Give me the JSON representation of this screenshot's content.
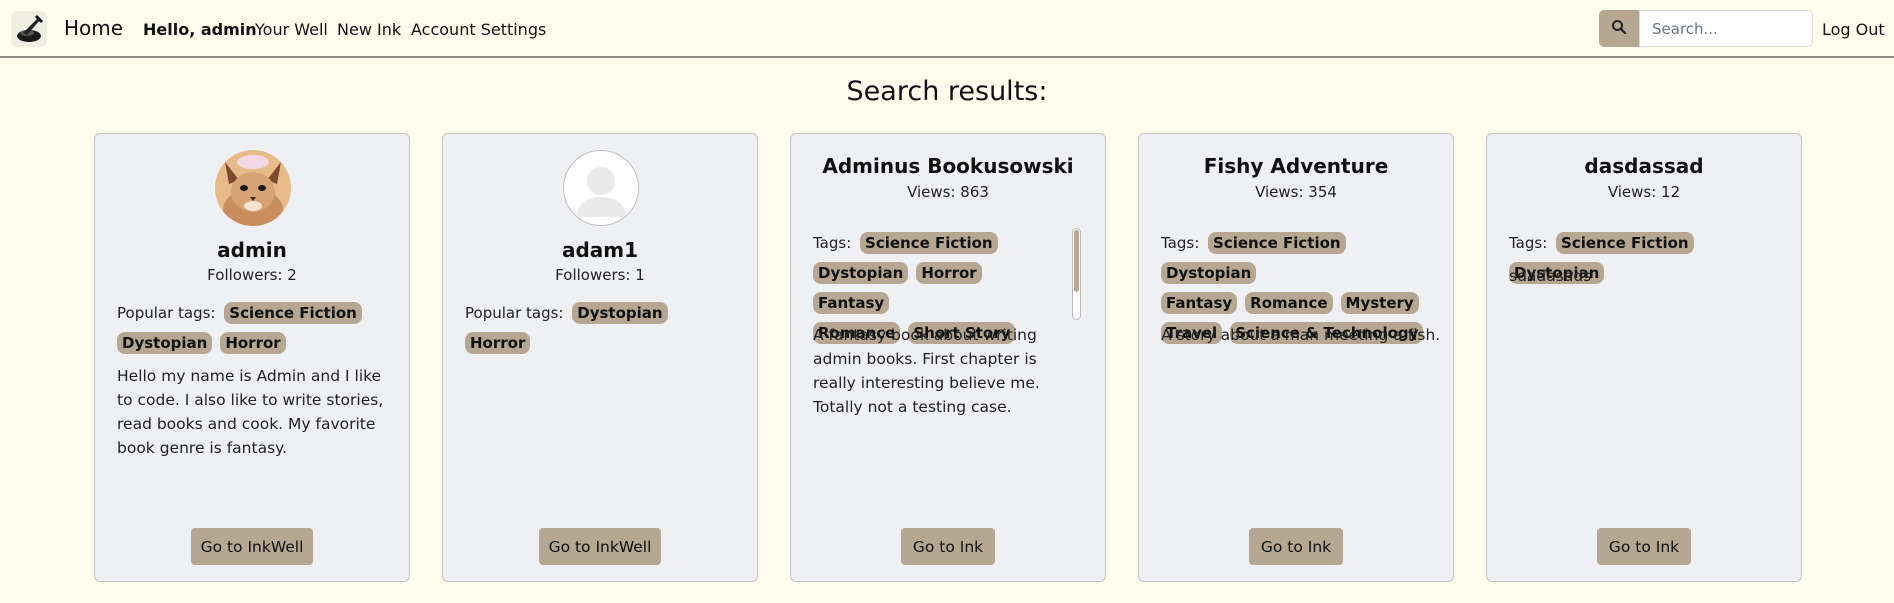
{
  "nav": {
    "home": "Home",
    "hello": "Hello, admin",
    "your_well": "Your Well",
    "new_ink": "New Ink",
    "account_settings": "Account Settings",
    "search_placeholder": "Search...",
    "logout": "Log Out"
  },
  "page_title": "Search results:",
  "users": [
    {
      "name": "admin",
      "followers": "Followers: 2",
      "tags_label": "Popular tags:",
      "tags": [
        "Science Fiction",
        "Dystopian",
        "Horror"
      ],
      "bio": "Hello my name is Admin and I like to code. I also like to write stories, read books and cook. My favorite book genre is fantasy.",
      "button": "Go to InkWell",
      "avatar": "cat-photo"
    },
    {
      "name": "adam1",
      "followers": "Followers: 1",
      "tags_label": "Popular tags:",
      "tags": [
        "Dystopian",
        "Horror"
      ],
      "bio": "",
      "button": "Go to InkWell",
      "avatar": "default-user-icon"
    }
  ],
  "inks": [
    {
      "title": "Adminus Bookusowski",
      "views": "Views: 863",
      "tags_label": "Tags:",
      "tags": [
        "Science Fiction",
        "Dystopian",
        "Horror",
        "Fantasy",
        "Romance",
        "Short Story"
      ],
      "description": "A fantasy book about writing admin books. First chapter is really interesting believe me. Totally not a testing case.",
      "button": "Go to Ink"
    },
    {
      "title": "Fishy Adventure",
      "views": "Views: 354",
      "tags_label": "Tags:",
      "tags": [
        "Science Fiction",
        "Dystopian",
        "Fantasy",
        "Romance",
        "Mystery",
        "Travel",
        "Science & Technology"
      ],
      "description": "A story about a man meeting a fish.",
      "button": "Go to Ink"
    },
    {
      "title": "dasdassad",
      "views": "Views: 12",
      "tags_label": "Tags:",
      "tags": [
        "Science Fiction",
        "Dystopian"
      ],
      "description": "sdadasads",
      "button": "Go to Ink"
    }
  ],
  "colors": {
    "background": "#fefdee",
    "accent": "#b5a791",
    "card": "#eff0f3"
  }
}
